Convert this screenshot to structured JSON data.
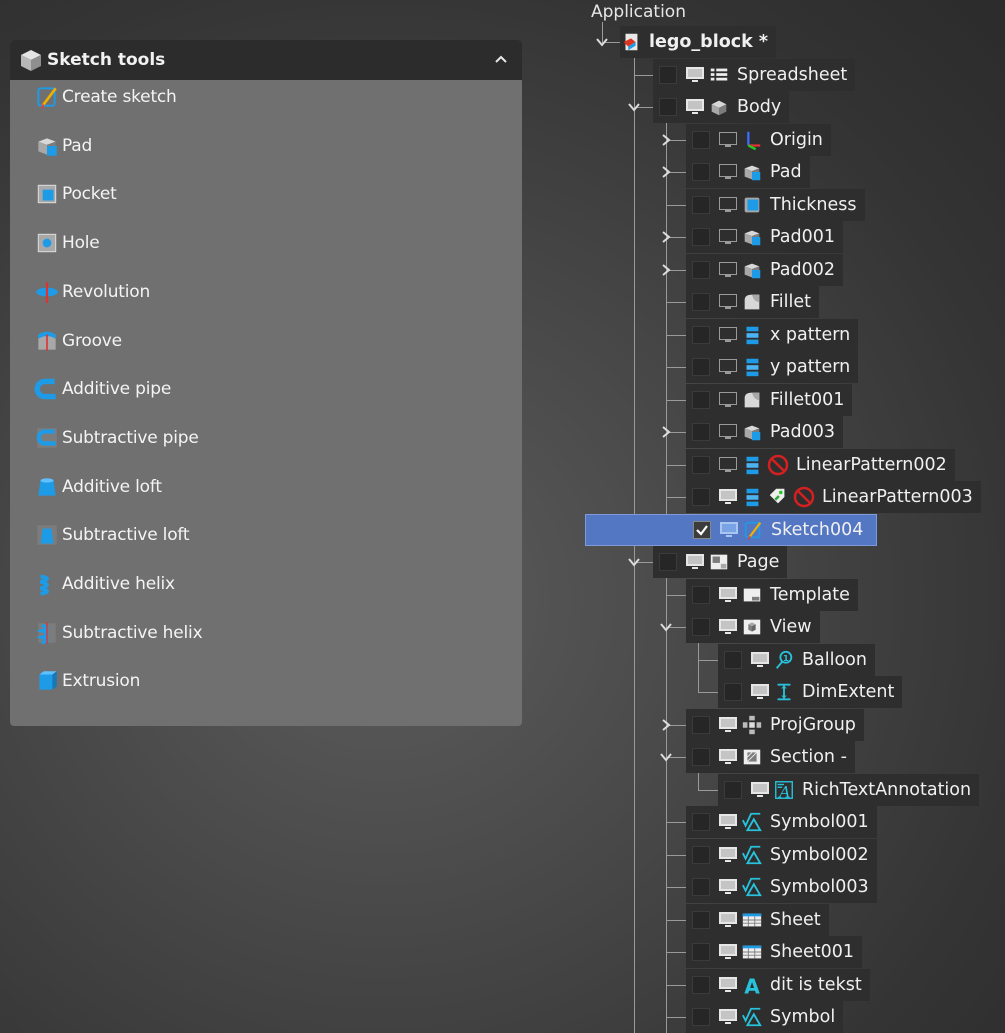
{
  "panel": {
    "title": "Sketch tools",
    "title_icon": "cube-icon",
    "collapse_icon": "chevron-up-icon",
    "tools": [
      {
        "label": "Create sketch",
        "icon": "sketch-icon"
      },
      {
        "label": "Pad",
        "icon": "pad-icon"
      },
      {
        "label": "Pocket",
        "icon": "pocket-icon"
      },
      {
        "label": "Hole",
        "icon": "hole-icon"
      },
      {
        "label": "Revolution",
        "icon": "revolution-icon"
      },
      {
        "label": "Groove",
        "icon": "groove-icon"
      },
      {
        "label": "Additive pipe",
        "icon": "additive-pipe-icon"
      },
      {
        "label": "Subtractive pipe",
        "icon": "subtractive-pipe-icon"
      },
      {
        "label": "Additive loft",
        "icon": "additive-loft-icon"
      },
      {
        "label": "Subtractive loft",
        "icon": "subtractive-loft-icon"
      },
      {
        "label": "Additive helix",
        "icon": "additive-helix-icon"
      },
      {
        "label": "Subtractive helix",
        "icon": "subtractive-helix-icon"
      },
      {
        "label": "Extrusion",
        "icon": "extrusion-icon"
      }
    ]
  },
  "tree": {
    "root_label": "Application",
    "items": [
      {
        "label": "lego_block *",
        "level": 0,
        "twist": "down",
        "eye": false,
        "icon": "document-icon",
        "checked": false,
        "bold": true
      },
      {
        "label": "Spreadsheet",
        "level": 1,
        "twist": "none",
        "eye": true,
        "icon": "spreadsheet-icon",
        "checked": false
      },
      {
        "label": "Body",
        "level": 1,
        "twist": "down",
        "eye": true,
        "icon": "body-icon",
        "checked": false
      },
      {
        "label": "Origin",
        "level": 2,
        "twist": "right",
        "eye": false,
        "icon": "axes-icon",
        "checked": false
      },
      {
        "label": "Pad",
        "level": 2,
        "twist": "right",
        "eye": false,
        "icon": "pad-icon",
        "checked": false
      },
      {
        "label": "Thickness",
        "level": 2,
        "twist": "none",
        "eye": false,
        "icon": "thickness-icon",
        "checked": false
      },
      {
        "label": "Pad001",
        "level": 2,
        "twist": "right",
        "eye": false,
        "icon": "pad-icon",
        "checked": false
      },
      {
        "label": "Pad002",
        "level": 2,
        "twist": "right",
        "eye": false,
        "icon": "pad-icon",
        "checked": false
      },
      {
        "label": "Fillet",
        "level": 2,
        "twist": "none",
        "eye": false,
        "icon": "fillet-icon",
        "checked": false
      },
      {
        "label": "x pattern",
        "level": 2,
        "twist": "none",
        "eye": false,
        "icon": "linear-pattern-icon",
        "checked": false
      },
      {
        "label": "y pattern",
        "level": 2,
        "twist": "none",
        "eye": false,
        "icon": "linear-pattern-icon",
        "checked": false
      },
      {
        "label": "Fillet001",
        "level": 2,
        "twist": "none",
        "eye": false,
        "icon": "fillet-icon",
        "checked": false
      },
      {
        "label": "Pad003",
        "level": 2,
        "twist": "right",
        "eye": false,
        "icon": "pad-icon",
        "checked": false
      },
      {
        "label": "LinearPattern002",
        "level": 2,
        "twist": "none",
        "eye": false,
        "icon": "linear-pattern-icon",
        "checked": false,
        "error": true
      },
      {
        "label": "LinearPattern003",
        "level": 2,
        "twist": "none",
        "eye": true,
        "icon": "linear-pattern-icon",
        "checked": false,
        "error": true,
        "tag": true
      },
      {
        "label": "Sketch004",
        "level": 2,
        "twist": "none",
        "eye": true,
        "icon": "sketch-icon",
        "checked": true,
        "selected": true
      },
      {
        "label": "Page",
        "level": 1,
        "twist": "down",
        "eye": true,
        "icon": "page-icon",
        "checked": false
      },
      {
        "label": "Template",
        "level": 2,
        "twist": "none",
        "eye": true,
        "icon": "template-icon",
        "checked": false
      },
      {
        "label": "View",
        "level": 2,
        "twist": "down",
        "eye": true,
        "icon": "view-icon",
        "checked": false
      },
      {
        "label": "Balloon",
        "level": 3,
        "twist": "none",
        "eye": true,
        "icon": "balloon-icon",
        "checked": false
      },
      {
        "label": "DimExtent",
        "level": 3,
        "twist": "none",
        "eye": true,
        "icon": "dim-extent-icon",
        "checked": false
      },
      {
        "label": "ProjGroup",
        "level": 2,
        "twist": "right",
        "eye": true,
        "icon": "projgroup-icon",
        "checked": false
      },
      {
        "label": "Section  -",
        "level": 2,
        "twist": "down",
        "eye": true,
        "icon": "section-icon",
        "checked": false
      },
      {
        "label": "RichTextAnnotation",
        "level": 3,
        "twist": "none",
        "eye": true,
        "icon": "rich-text-icon",
        "checked": false
      },
      {
        "label": "Symbol001",
        "level": 2,
        "twist": "none",
        "eye": true,
        "icon": "symbol-icon",
        "checked": false
      },
      {
        "label": "Symbol002",
        "level": 2,
        "twist": "none",
        "eye": true,
        "icon": "symbol-icon",
        "checked": false
      },
      {
        "label": "Symbol003",
        "level": 2,
        "twist": "none",
        "eye": true,
        "icon": "symbol-icon",
        "checked": false
      },
      {
        "label": "Sheet",
        "level": 2,
        "twist": "none",
        "eye": true,
        "icon": "sheet-icon",
        "checked": false
      },
      {
        "label": "Sheet001",
        "level": 2,
        "twist": "none",
        "eye": true,
        "icon": "sheet-icon",
        "checked": false
      },
      {
        "label": "dit is tekst",
        "level": 2,
        "twist": "none",
        "eye": true,
        "icon": "annotation-text-icon",
        "checked": false
      },
      {
        "label": "Symbol",
        "level": 2,
        "twist": "none",
        "eye": true,
        "icon": "symbol-icon",
        "checked": false
      }
    ]
  },
  "colors": {
    "panel_header": "#2c2c2c",
    "panel_body": "#707070",
    "tree_row": "#2e2e2e",
    "selection": "#5477c3",
    "accent_blue": "#1e9be6",
    "accent_cyan": "#27c3dc",
    "error_red": "#d42020"
  }
}
